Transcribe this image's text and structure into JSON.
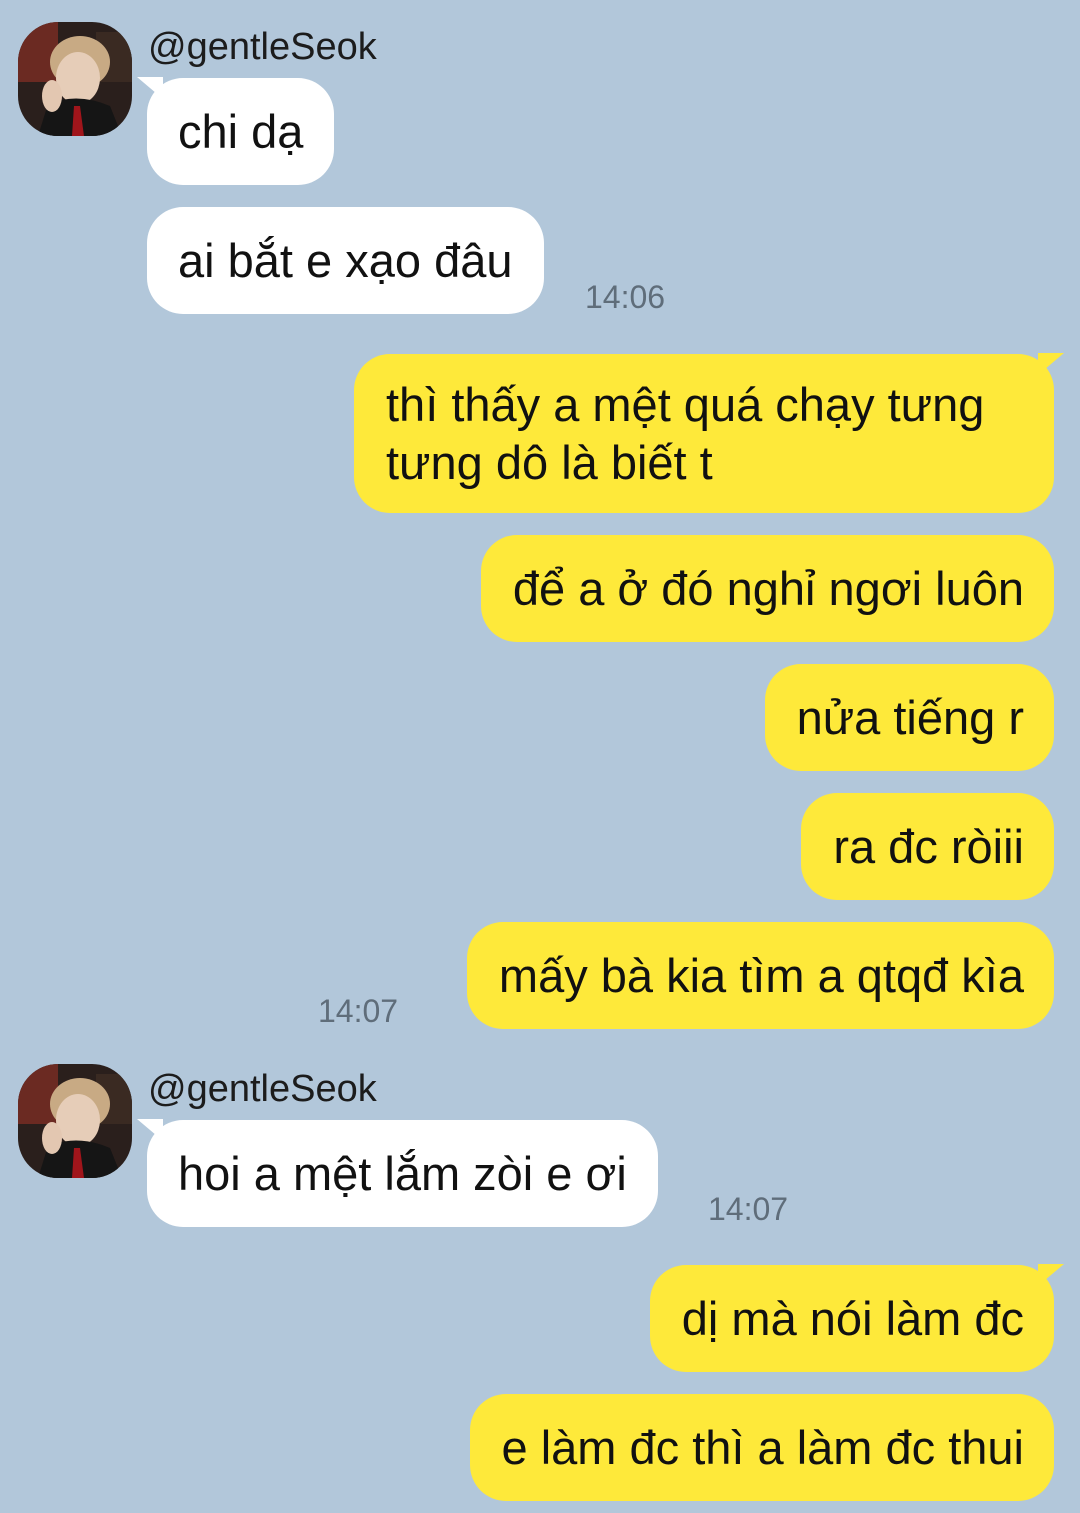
{
  "conversation": {
    "group1": {
      "sender": "@gentleSeok",
      "messages": [
        "chi dạ",
        "ai bắt e xạo đâu"
      ],
      "time": "14:06"
    },
    "group2": {
      "messages": [
        "thì thấy a mệt quá chạy tưng tưng dô là biết t",
        "để a ở đó nghỉ ngơi luôn",
        "nửa tiếng r",
        "ra đc ròiii",
        "mấy bà kia tìm a qtqđ kìa"
      ],
      "time": "14:07"
    },
    "group3": {
      "sender": "@gentleSeok",
      "messages": [
        "hoi a mệt lắm zòi e ơi"
      ],
      "time": "14:07"
    },
    "group4": {
      "messages": [
        "dị mà nói làm đc",
        "e làm đc thì a làm đc thui"
      ]
    }
  },
  "colors": {
    "background": "#b2c7da",
    "incoming_bubble": "#ffffff",
    "outgoing_bubble": "#fee93a",
    "timestamp": "#5f6d7a"
  },
  "icons": {
    "avatar": "profile-photo-avatar"
  }
}
